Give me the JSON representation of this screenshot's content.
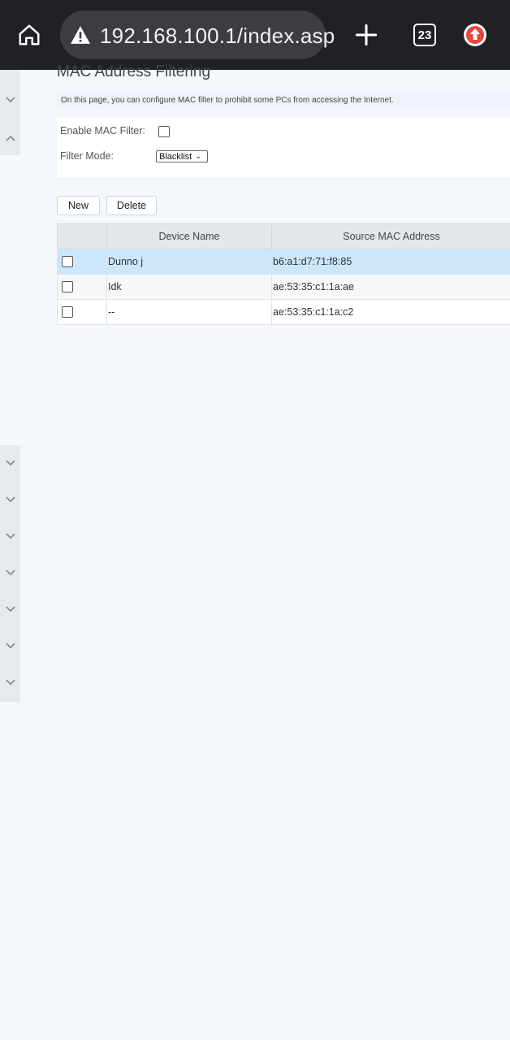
{
  "browser": {
    "url": "192.168.100.1/index.asp",
    "tab_count": "23",
    "icons": [
      "home-icon",
      "warning-icon",
      "plus-icon",
      "tab-switcher-icon",
      "update-icon"
    ]
  },
  "page": {
    "title": "MAC Address Filtering",
    "description": "On this page, you can configure MAC filter to prohibit some PCs from accessing the Internet."
  },
  "form": {
    "enable_label": "Enable MAC Filter:",
    "enable_checked": false,
    "mode_label": "Filter Mode:",
    "mode_value": "Blacklist"
  },
  "actions": {
    "new_label": "New",
    "delete_label": "Delete"
  },
  "table": {
    "headers": [
      "",
      "Device Name",
      "Source MAC Address"
    ],
    "rows": [
      {
        "device": "Dunno j",
        "mac": "b6:a1:d7:71:f8:85",
        "selected": true
      },
      {
        "device": "Idk",
        "mac": "ae:53:35:c1:1a:ae",
        "selected": false
      },
      {
        "device": "--",
        "mac": "ae:53:35:c1:1a:c2",
        "selected": false
      }
    ]
  },
  "colors": {
    "toolbar_bg": "#202124",
    "selected_row": "#cce6fb",
    "update_badge": "#e8453c"
  }
}
